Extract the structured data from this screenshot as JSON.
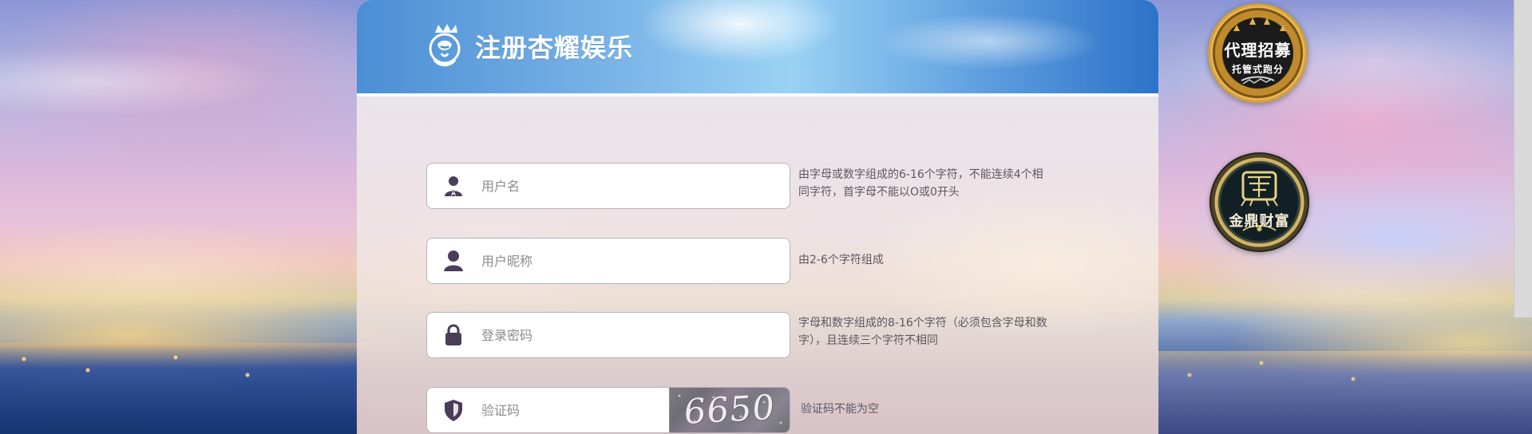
{
  "header": {
    "title": "注册杏耀娱乐",
    "logo_icon": "crown-mask-logo-icon"
  },
  "form": {
    "username": {
      "placeholder": "用户名",
      "helper": "由字母或数字组成的6-16个字符，不能连续4个相同字符，首字母不能以O或0开头",
      "icon": "user-suit-icon"
    },
    "nickname": {
      "placeholder": "用户昵称",
      "helper": "由2-6个字符组成",
      "icon": "user-icon"
    },
    "password": {
      "placeholder": "登录密码",
      "helper": "字母和数字组成的8-16个字符（必须包含字母和数字），且连续三个字符不相同",
      "icon": "lock-icon"
    },
    "captcha": {
      "placeholder": "验证码",
      "helper": "验证码不能为空",
      "code": "6650",
      "icon": "shield-icon"
    }
  },
  "badges": {
    "agent": {
      "title": "代理招募",
      "subtitle": "托管式跑分",
      "colors": {
        "gold": "#c08b2c",
        "dark": "#1b1b1b"
      }
    },
    "wealth": {
      "title": "金鼎财富",
      "colors": {
        "gold": "#c7b15e",
        "dark": "#122026"
      }
    }
  },
  "colors": {
    "header_accent": "#4b8ed4",
    "icon": "#4b3d59",
    "helper_text": "#5d5860"
  }
}
